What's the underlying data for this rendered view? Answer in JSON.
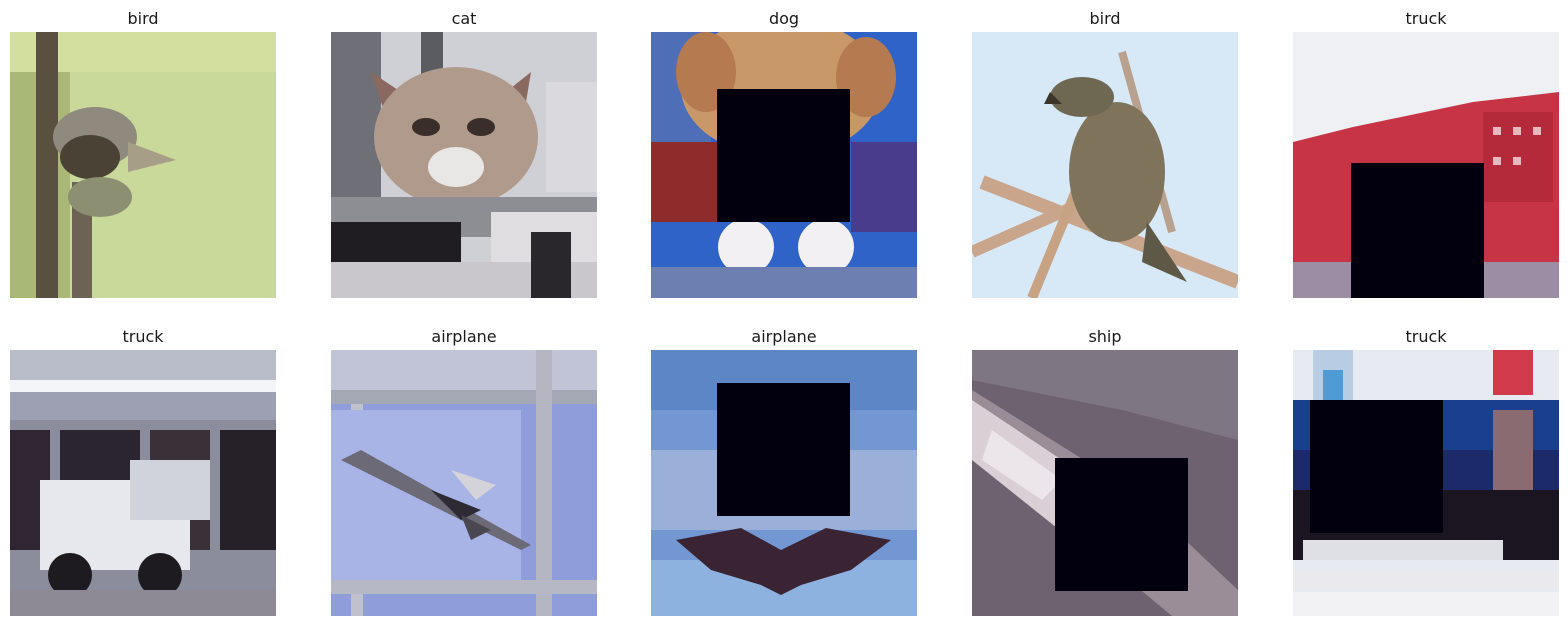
{
  "figure": {
    "panels": [
      {
        "title": "bird",
        "occluded": false
      },
      {
        "title": "cat",
        "occluded": false
      },
      {
        "title": "dog",
        "occluded": true
      },
      {
        "title": "bird",
        "occluded": false
      },
      {
        "title": "truck",
        "occluded": true
      },
      {
        "title": "truck",
        "occluded": false
      },
      {
        "title": "airplane",
        "occluded": false
      },
      {
        "title": "airplane",
        "occluded": true
      },
      {
        "title": "ship",
        "occluded": true
      },
      {
        "title": "truck",
        "occluded": true
      }
    ],
    "colors": {
      "occluder": "#02000e",
      "background": "#ffffff"
    }
  }
}
